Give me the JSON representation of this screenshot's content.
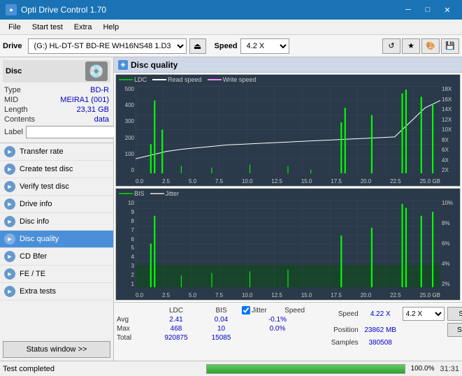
{
  "titlebar": {
    "title": "Opti Drive Control 1.70",
    "icon": "●",
    "controls": {
      "minimize": "─",
      "maximize": "□",
      "close": "✕"
    }
  },
  "menubar": {
    "items": [
      "File",
      "Start test",
      "Extra",
      "Help"
    ]
  },
  "drivebar": {
    "label": "Drive",
    "drive_value": "(G:) HL-DT-ST BD-RE  WH16NS48 1.D3",
    "speed_label": "Speed",
    "speed_value": "4.2 X",
    "action_icons": [
      "eject",
      "refresh",
      "star",
      "save"
    ]
  },
  "sidebar": {
    "disc_section": {
      "title": "Disc",
      "type_label": "Type",
      "type_value": "BD-R",
      "mid_label": "MID",
      "mid_value": "MEIRA1 (001)",
      "length_label": "Length",
      "length_value": "23,31 GB",
      "contents_label": "Contents",
      "contents_value": "data",
      "label_label": "Label",
      "label_placeholder": ""
    },
    "menu_items": [
      {
        "id": "transfer-rate",
        "label": "Transfer rate",
        "icon": "►"
      },
      {
        "id": "create-test-disc",
        "label": "Create test disc",
        "icon": "►"
      },
      {
        "id": "verify-test-disc",
        "label": "Verify test disc",
        "icon": "►"
      },
      {
        "id": "drive-info",
        "label": "Drive info",
        "icon": "►"
      },
      {
        "id": "disc-info",
        "label": "Disc info",
        "icon": "►"
      },
      {
        "id": "disc-quality",
        "label": "Disc quality",
        "icon": "►",
        "active": true
      },
      {
        "id": "cd-bfer",
        "label": "CD Bfer",
        "icon": "►"
      },
      {
        "id": "fe-te",
        "label": "FE / TE",
        "icon": "►"
      },
      {
        "id": "extra-tests",
        "label": "Extra tests",
        "icon": "►"
      }
    ],
    "status_btn": "Status window >>"
  },
  "disc_quality": {
    "title": "Disc quality",
    "icon": "◈",
    "chart1": {
      "legend": [
        {
          "label": "LDC",
          "color": "#00bb00"
        },
        {
          "label": "Read speed",
          "color": "#ffffff"
        },
        {
          "label": "Write speed",
          "color": "#ff88ff"
        }
      ],
      "y_labels_left": [
        "500",
        "400",
        "300",
        "200",
        "100",
        "0"
      ],
      "y_labels_right": [
        "18X",
        "16X",
        "14X",
        "12X",
        "10X",
        "8X",
        "6X",
        "4X",
        "2X"
      ],
      "x_labels": [
        "0.0",
        "2.5",
        "5.0",
        "7.5",
        "10.0",
        "12.5",
        "15.0",
        "17.5",
        "20.0",
        "22.5",
        "25.0 GB"
      ]
    },
    "chart2": {
      "legend": [
        {
          "label": "BIS",
          "color": "#00bb00"
        },
        {
          "label": "Jitter",
          "color": "#bbbbbb"
        }
      ],
      "y_labels_left": [
        "10",
        "9",
        "8",
        "7",
        "6",
        "5",
        "4",
        "3",
        "2",
        "1"
      ],
      "y_labels_right": [
        "10%",
        "8%",
        "6%",
        "4%",
        "2%"
      ],
      "x_labels": [
        "0.0",
        "2.5",
        "5.0",
        "7.5",
        "10.0",
        "12.5",
        "15.0",
        "17.5",
        "20.0",
        "22.5",
        "25.0 GB"
      ]
    },
    "stats": {
      "headers": [
        "",
        "LDC",
        "BIS",
        "",
        "Jitter",
        "Speed",
        ""
      ],
      "avg_label": "Avg",
      "avg_ldc": "2.41",
      "avg_bis": "0.04",
      "avg_jitter": "-0.1%",
      "max_label": "Max",
      "max_ldc": "468",
      "max_bis": "10",
      "max_jitter": "0.0%",
      "total_label": "Total",
      "total_ldc": "920875",
      "total_bis": "15085",
      "jitter_checked": true,
      "speed_label": "Speed",
      "speed_value": "4.22 X",
      "speed_select": "4.2 X",
      "position_label": "Position",
      "position_value": "23862 MB",
      "samples_label": "Samples",
      "samples_value": "380508",
      "btn_start_full": "Start full",
      "btn_start_part": "Start part"
    }
  },
  "statusbar": {
    "status_text": "Test completed",
    "progress": 100,
    "progress_text": "100.0%",
    "time": "31:31"
  }
}
